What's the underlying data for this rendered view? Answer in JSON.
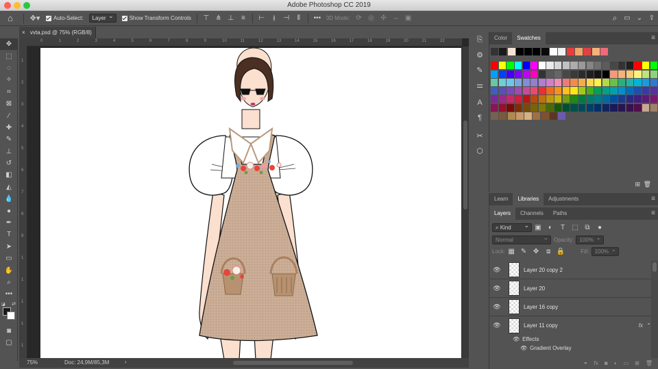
{
  "window": {
    "title": "Adobe Photoshop CC 2019",
    "traffic": {
      "close": "#fe5f57",
      "min": "#febc2e",
      "max": "#28c840"
    }
  },
  "options_bar": {
    "auto_select_label": "Auto-Select:",
    "auto_select_value": "Layer",
    "show_transform_label": "Show Transform Controls",
    "mode_3d_label": "3D Mode:"
  },
  "document": {
    "tab_title": "vvta.psd @ 75% (RGB/8)",
    "zoom": "75%",
    "doc_info": "Doc: 24,9M/85,3M",
    "ruler_h_ticks": [
      "0",
      "1",
      "2",
      "3",
      "4",
      "5",
      "6",
      "7",
      "8",
      "9",
      "10",
      "11",
      "12",
      "13",
      "14",
      "15",
      "16",
      "17",
      "18",
      "19",
      "20",
      "21",
      "22"
    ],
    "ruler_v_ticks": [
      "1",
      "2",
      "3",
      "4",
      "5",
      "6",
      "7",
      "8",
      "9",
      "1",
      "1",
      "1",
      "1",
      "1"
    ]
  },
  "swatches_panel": {
    "tabs": [
      "Color",
      "Swatches"
    ],
    "active_tab": "Swatches",
    "recent": [
      "#333333",
      "#1a1a1a",
      "#f5e3d3",
      "#000000",
      "#000000",
      "#000000",
      "#0a0a0a",
      "#ffffff",
      "#f2f2f2",
      "#ea3b3b",
      "#f2a46b",
      "#e04141",
      "#f7b27a",
      "#f06a7a"
    ],
    "rows": [
      [
        "#ff0000",
        "#ffff00",
        "#00ff00",
        "#00ffff",
        "#0000ff",
        "#ff00ff",
        "#ffffff",
        "#ebebeb",
        "#d6d6d6",
        "#c2c2c2",
        "#adadad",
        "#999999",
        "#858585",
        "#707070",
        "#5c5c5c",
        "#474747",
        "#333333",
        "#1f1f1f",
        "#ff0000",
        "#ffff00",
        "#00ff00"
      ],
      [
        "#00a0ff",
        "#0040ff",
        "#4000ff",
        "#8000ff",
        "#c000ff",
        "#ff00c0",
        "#333333",
        "#595959",
        "#666666",
        "#474747",
        "#3a3a3a",
        "#2b2b2b",
        "#1f1f1f",
        "#141414",
        "#000000",
        "#f59a7a",
        "#f7b27a",
        "#fbc97a",
        "#fff27a",
        "#c2e27a",
        "#8dd37a"
      ],
      [
        "#65c8a6",
        "#6fcfd6",
        "#6ec6f0",
        "#79a7e0",
        "#7f8ed6",
        "#927fd1",
        "#b07fd1",
        "#d17fc8",
        "#f08db2",
        "#ef7a7a",
        "#f08d4a",
        "#f5ad4a",
        "#fbd94a",
        "#fff04a",
        "#b3d94a",
        "#6cc04a",
        "#2bb07a",
        "#1fb5a8",
        "#00b4d8",
        "#1a9be0",
        "#2f79d0"
      ],
      [
        "#3f5fc0",
        "#5a4fb8",
        "#7a4ab8",
        "#a04ab0",
        "#c84a9a",
        "#e84a6e",
        "#ec2f2f",
        "#f06a1a",
        "#f5931a",
        "#fbc01a",
        "#ffe61a",
        "#9ecb1a",
        "#3fb21a",
        "#00a05a",
        "#00a08a",
        "#00a0b0",
        "#0090d0",
        "#006ec0",
        "#1e4fb0",
        "#3a3aa5",
        "#5a2fa0"
      ],
      [
        "#7d2a98",
        "#a0288a",
        "#c8286a",
        "#d01e3e",
        "#b81616",
        "#b84a0e",
        "#c07010",
        "#c09810",
        "#c8b810",
        "#70a010",
        "#208a10",
        "#007a42",
        "#007a6a",
        "#007a8a",
        "#006aa0",
        "#0050a0",
        "#1a3a90",
        "#2a2a80",
        "#40207a",
        "#5a1a78",
        "#7a1870"
      ],
      [
        "#8a1456",
        "#9a0e2e",
        "#7a0a0a",
        "#7a3006",
        "#7a4a08",
        "#7a6408",
        "#807808",
        "#4a6a08",
        "#145a08",
        "#005030",
        "#005048",
        "#004a58",
        "#004068",
        "#003068",
        "#102460",
        "#1a1a58",
        "#281450",
        "#3a104e",
        "#500e4a",
        "#c8a890",
        "#a08068"
      ],
      [
        "#7a6050",
        "#7a5a3a",
        "#b08850",
        "#c89a68",
        "#d8b080",
        "#a07040",
        "#805030",
        "#5a3820",
        "#6a5ab0"
      ]
    ]
  },
  "libraries_panel": {
    "tabs": [
      "Learn",
      "Libraries",
      "Adjustments"
    ],
    "active_tab": "Libraries"
  },
  "layers_panel": {
    "tabs": [
      "Layers",
      "Channels",
      "Paths"
    ],
    "active_tab": "Layers",
    "filter_kind": "Kind",
    "blend_mode": "Normal",
    "opacity_label": "Opacity:",
    "opacity_value": "100%",
    "lock_label": "Lock:",
    "fill_label": "Fill:",
    "fill_value": "100%",
    "layers": [
      {
        "name": "Layer 20 copy 2",
        "fx": ""
      },
      {
        "name": "Layer 20",
        "fx": ""
      },
      {
        "name": "Layer 16 copy",
        "fx": ""
      },
      {
        "name": "Layer 11 copy",
        "fx": "fx"
      }
    ],
    "effects_label": "Effects",
    "effect_item": "Gradient Overlay"
  },
  "colors": {
    "fg": "#1a1a1a",
    "bg": "#ffffff",
    "dress": "#c9ab94",
    "hair": "#4a2f22",
    "skin": "#fbdfcf",
    "collar_trim": "#b99a7e"
  }
}
